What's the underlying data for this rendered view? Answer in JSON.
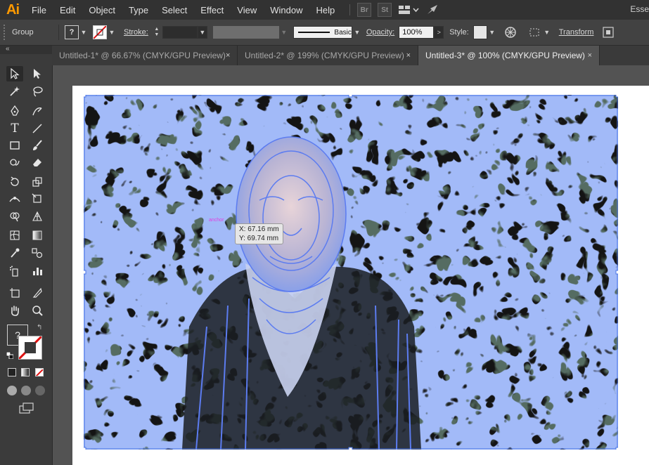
{
  "app": {
    "logo": "Ai",
    "workspace": "Esse"
  },
  "menu": [
    "File",
    "Edit",
    "Object",
    "Type",
    "Select",
    "Effect",
    "View",
    "Window",
    "Help"
  ],
  "menu_icons": {
    "bridge": "Br",
    "stock": "St"
  },
  "control_bar": {
    "selection_type": "Group",
    "stroke_label": "Stroke:",
    "brush_label": "Basic",
    "opacity_label": "Opacity:",
    "opacity_value": "100%",
    "style_label": "Style:",
    "transform_label": "Transform"
  },
  "tabs": [
    {
      "label": "Untitled-1* @ 66.67% (CMYK/GPU Preview)",
      "active": false
    },
    {
      "label": "Untitled-2* @ 199% (CMYK/GPU Preview)",
      "active": false
    },
    {
      "label": "Untitled-3* @ 100% (CMYK/GPU Preview)",
      "active": true
    }
  ],
  "tab_close_symbol": "×",
  "fill_stroke": {
    "fill_placeholder": "?"
  },
  "coordinates": {
    "x": "X: 67.16 mm",
    "y": "Y: 69.74 mm"
  },
  "colors": {
    "accent": "#ff9a00",
    "path_outline": "#5c7cf0",
    "selection": "#4b75e6",
    "background_dark": "#141414"
  }
}
